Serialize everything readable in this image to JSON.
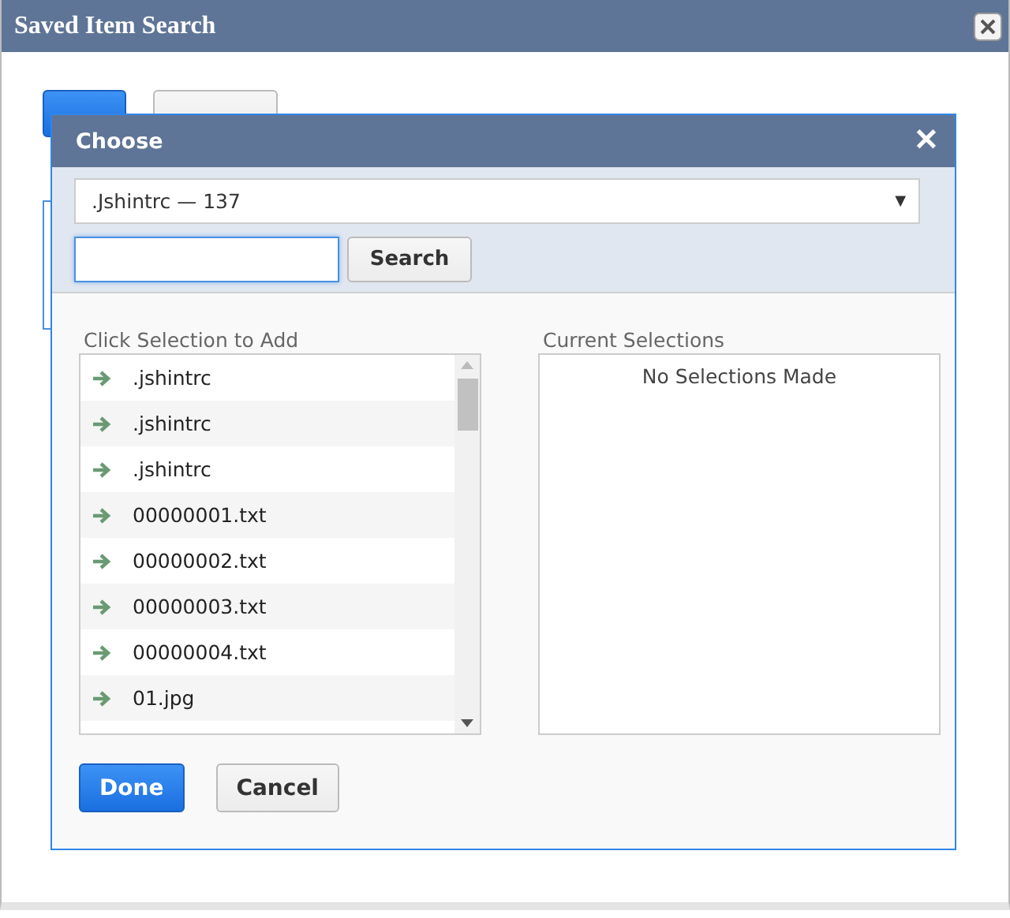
{
  "window": {
    "title": "Saved Item Search"
  },
  "back_buttons": [
    {
      "kind": "primary"
    },
    {
      "kind": "default"
    }
  ],
  "dialog": {
    "title": "Choose",
    "close": "✕",
    "dropdown": {
      "value": ".Jshintrc — 137",
      "caret": "▼"
    },
    "search": {
      "button": "Search"
    },
    "available": {
      "heading": "Click Selection to Add",
      "items": [
        ".jshintrc",
        ".jshintrc",
        ".jshintrc",
        "00000001.txt",
        "00000002.txt",
        "00000003.txt",
        "00000004.txt",
        "01.jpg"
      ]
    },
    "current": {
      "heading": "Current Selections",
      "empty_text": "No Selections Made"
    },
    "buttons": [
      {
        "label": "Done",
        "kind": "primary"
      },
      {
        "label": "Cancel",
        "kind": "default"
      }
    ]
  }
}
